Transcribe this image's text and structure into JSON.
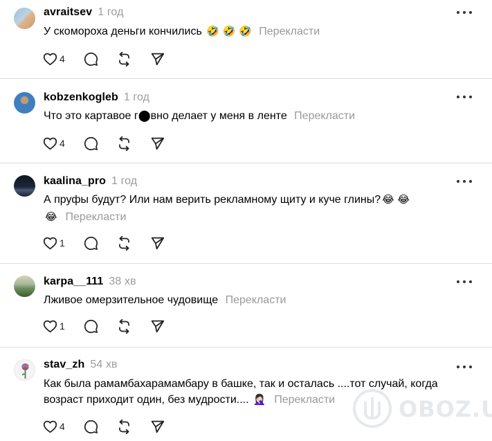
{
  "posts": [
    {
      "username": "avraitsev",
      "time": "1 год",
      "text": "У скомороха деньги кончились",
      "emojis": "🤣 🤣 🤣",
      "translate": "Перекласти",
      "likes": "4",
      "avatar_colors": [
        "#9cc0d8",
        "#e0b48c"
      ]
    },
    {
      "username": "kobzenkogleb",
      "time": "1 год",
      "text": "Что это картавое г⬤вно делает у меня в ленте",
      "emojis": "",
      "translate": "Перекласти",
      "likes": "4",
      "avatar_colors": [
        "#3f7fbf",
        "#c49a72"
      ]
    },
    {
      "username": "kaalina_pro",
      "time": "1 год",
      "text": "А пруфы будут? Или нам верить рекламному щиту и куче глины?",
      "emojis": "😂 😂",
      "emojis_line2": "😂",
      "translate": "Перекласти",
      "likes": "1",
      "avatar_colors": [
        "#1d2636",
        "#4a5a72"
      ]
    },
    {
      "username": "karpa__111",
      "time": "38 хв",
      "text": "Лживое омерзительное чудовище",
      "emojis": "",
      "translate": "Перекласти",
      "likes": "1",
      "avatar_colors": [
        "#6b8f5a",
        "#d8d2c0"
      ]
    },
    {
      "username": "stav_zh",
      "time": "54 хв",
      "text_line1": "Как была рамамбахарамамбару в башке, так и осталась ....тот случай, когда",
      "text_line2": "возраст приходит один, без мудрости....",
      "emojis": "🤦🏻‍♀️",
      "translate": "Перекласти",
      "likes": "4",
      "avatar_colors": [
        "#f4f4f4",
        "#8a5a7a"
      ]
    }
  ],
  "icons": {
    "like": "heart-icon",
    "reply": "comment-icon",
    "repost": "repost-icon",
    "share": "send-icon",
    "more": "more-options-icon"
  },
  "watermark": {
    "text": "OBOZ.UA"
  }
}
